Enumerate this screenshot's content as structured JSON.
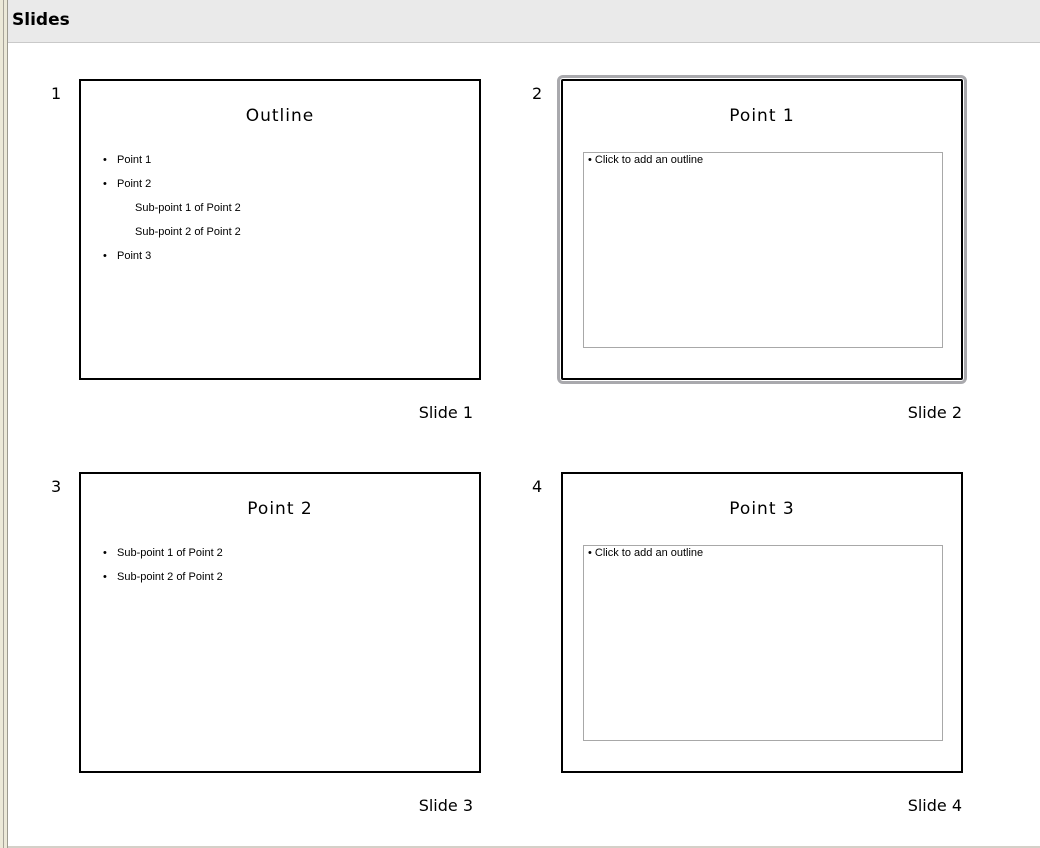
{
  "panel": {
    "title": "Slides"
  },
  "slides": [
    {
      "number": "1",
      "title": "Outline",
      "bullets": [
        {
          "text": "Point 1",
          "level": 1
        },
        {
          "text": "Point 2",
          "level": 1
        },
        {
          "text": "Sub-point 1 of Point 2",
          "level": 2
        },
        {
          "text": "Sub-point 2 of Point 2",
          "level": 2
        },
        {
          "text": "Point 3",
          "level": 1
        }
      ],
      "caption": "Slide 1",
      "selected": false
    },
    {
      "number": "2",
      "title": "Point 1",
      "placeholder": "Click to add an outline",
      "caption": "Slide 2",
      "selected": true
    },
    {
      "number": "3",
      "title": "Point 2",
      "bullets": [
        {
          "text": "Sub-point 1 of Point 2",
          "level": 1
        },
        {
          "text": "Sub-point 2 of Point 2",
          "level": 1
        }
      ],
      "caption": "Slide 3",
      "selected": false
    },
    {
      "number": "4",
      "title": "Point 3",
      "placeholder": "Click to add an outline",
      "caption": "Slide 4",
      "selected": false
    }
  ],
  "bullet_glyph": "•"
}
